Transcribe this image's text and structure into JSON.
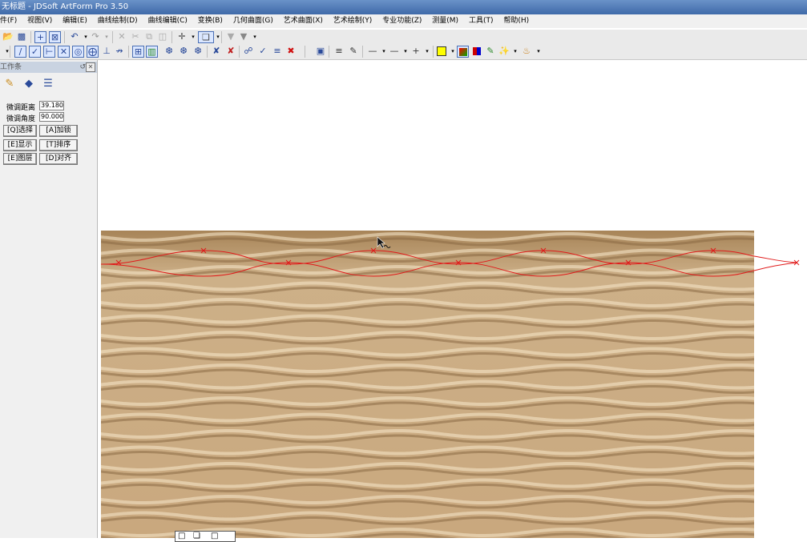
{
  "window": {
    "title": "无标题 - JDSoft ArtForm Pro 3.50"
  },
  "menu": [
    "件(F)",
    "视图(V)",
    "编辑(E)",
    "曲线绘制(D)",
    "曲线编辑(C)",
    "变换(B)",
    "几何曲面(G)",
    "艺术曲面(X)",
    "艺术绘制(Y)",
    "专业功能(Z)",
    "测量(M)",
    "工具(T)",
    "帮助(H)"
  ],
  "panel": {
    "title": "工作条",
    "fields": [
      {
        "label": "微调距离",
        "value": "39.180"
      },
      {
        "label": "微调角度",
        "value": "90.000"
      }
    ],
    "buttons": [
      [
        "[Q]选择",
        "[A]加锁"
      ],
      [
        "[E]显示",
        "[T]排序"
      ],
      [
        "[E]图层",
        "[D]对齐"
      ]
    ]
  },
  "colors": {
    "accent": "#3f6aa9",
    "curve": "#e01a1a"
  }
}
